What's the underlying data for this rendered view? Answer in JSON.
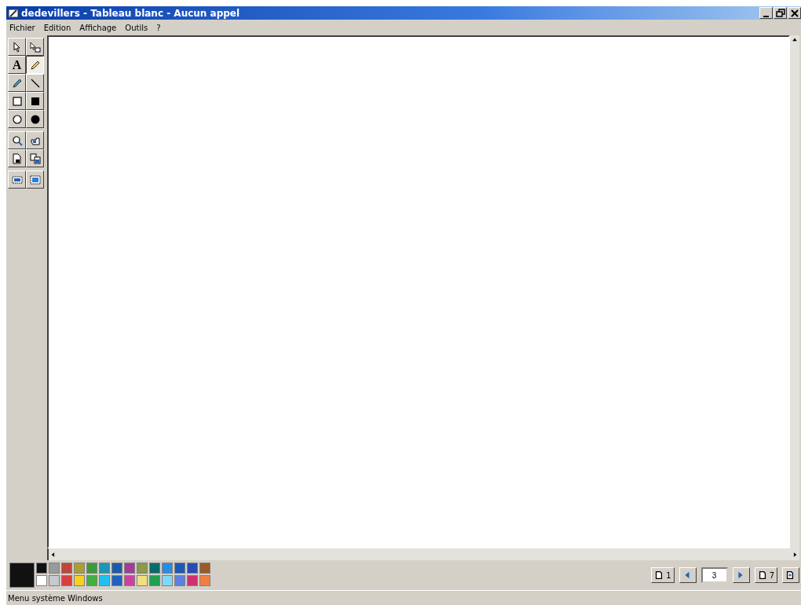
{
  "window": {
    "title": "dedevillers - Tableau blanc - Aucun appel"
  },
  "menu": [
    "Fichier",
    "Edition",
    "Affichage",
    "Outils",
    "?"
  ],
  "tools": [
    {
      "kind": "arrow",
      "selected": false
    },
    {
      "kind": "arrow-box",
      "selected": false
    },
    {
      "kind": "text",
      "label": "A",
      "selected": false
    },
    {
      "kind": "highlighter",
      "selected": true
    },
    {
      "kind": "pen",
      "selected": false
    },
    {
      "kind": "line",
      "selected": false
    },
    {
      "kind": "rect",
      "selected": false
    },
    {
      "kind": "rect-filled",
      "selected": false
    },
    {
      "kind": "ellipse",
      "selected": false
    },
    {
      "kind": "ellipse-filled",
      "selected": false
    },
    {
      "kind": "zoom",
      "selected": false
    },
    {
      "kind": "hand",
      "selected": false
    },
    {
      "kind": "lock",
      "selected": false
    },
    {
      "kind": "sync",
      "selected": false
    },
    {
      "kind": "capture-area",
      "selected": false
    },
    {
      "kind": "capture-window",
      "selected": false
    }
  ],
  "palette": {
    "current": {
      "color": "#111111"
    },
    "colors": [
      {
        "color": "#111111"
      },
      {
        "color": "#9a9a9a"
      },
      {
        "color": "#c0443c"
      },
      {
        "color": "#a8a032"
      },
      {
        "color": "#3c9a3c"
      },
      {
        "color": "#1c96b4"
      },
      {
        "color": "#1e5aa8"
      },
      {
        "color": "#a03c9a"
      },
      {
        "color": "#8c9a4a"
      },
      {
        "color": "#0a6a6a"
      },
      {
        "color": "#2a8ce0"
      },
      {
        "color": "#1c5ab4"
      },
      {
        "color": "#2a4ab4"
      },
      {
        "color": "#9a5a2a"
      },
      {
        "color": "#ffffff"
      },
      {
        "color": "#c8c8d0"
      },
      {
        "color": "#d84040"
      },
      {
        "color": "#f8d020"
      },
      {
        "color": "#40b040"
      },
      {
        "color": "#20c0f0"
      },
      {
        "color": "#2060c0"
      },
      {
        "color": "#d040a0"
      },
      {
        "color": "#f0e080"
      },
      {
        "color": "#20a050"
      },
      {
        "color": "#80d8f8"
      },
      {
        "color": "#6080e0"
      },
      {
        "color": "#d03070"
      },
      {
        "color": "#f08040"
      }
    ]
  },
  "pages": {
    "first": "1",
    "current": "3",
    "last": "7"
  },
  "status_bar": "Menu système Windows"
}
